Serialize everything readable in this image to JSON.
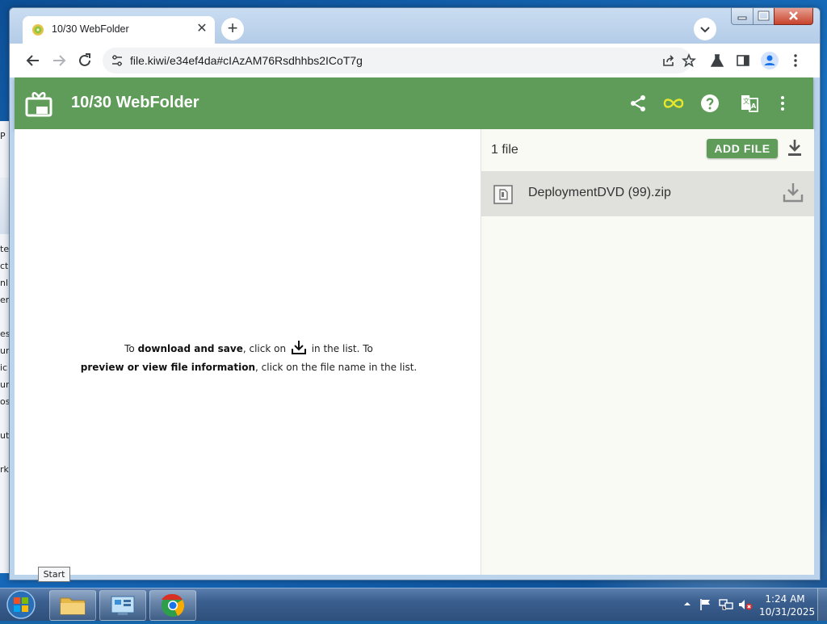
{
  "browser": {
    "tab": {
      "title": "10/30 WebFolder"
    },
    "address": {
      "url": "file.kiwi/e34ef4da#cIAzAM76Rsdhhbs2ICoT7g"
    }
  },
  "app": {
    "title": "10/30 WebFolder",
    "hint": {
      "part1": "To ",
      "bold1": "download and save",
      "part2": ", click on",
      "part3": "in the list. To",
      "bold2": "preview or view file information",
      "part4": ", click on the file name in the list."
    },
    "file_count": "1 file",
    "add_file_label": "ADD FILE",
    "files": [
      {
        "name": "DeploymentDVD (99).zip"
      }
    ],
    "colors": {
      "brand": "#5f9c5a",
      "infinity": "#e8e82a"
    }
  },
  "desktop": {
    "background_fragments": [
      "P",
      "te",
      "cto",
      "nl",
      "en",
      "es",
      "ur",
      "ic",
      "ur",
      "os",
      "ut",
      "rk"
    ]
  },
  "tooltip": {
    "text": "Start"
  },
  "taskbar": {
    "clock": {
      "time": "1:24 AM",
      "date": "10/31/2025"
    }
  }
}
